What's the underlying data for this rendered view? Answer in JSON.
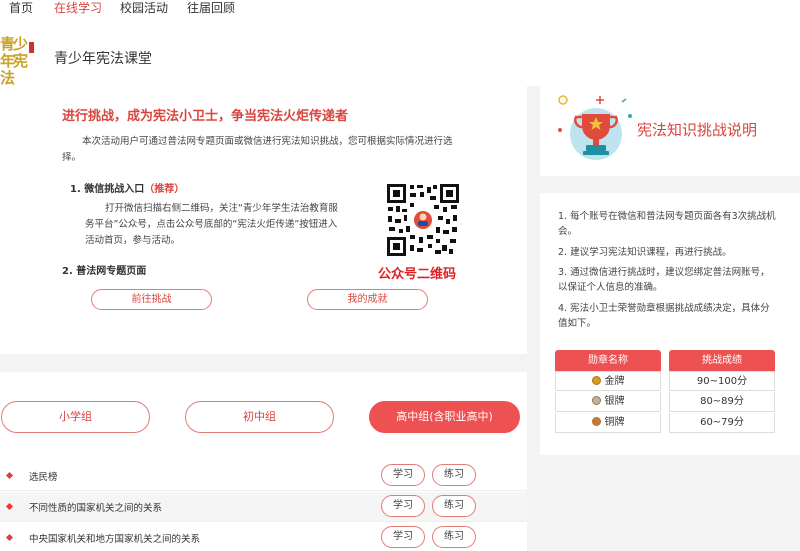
{
  "nav": {
    "items": [
      {
        "label": "首页"
      },
      {
        "label": "在线学习"
      },
      {
        "label": "校园活动"
      },
      {
        "label": "往届回顾"
      }
    ],
    "active_label": "在线学习"
  },
  "header": {
    "logo_text": "青少年宪法",
    "site_title": "青少年宪法课堂"
  },
  "challenge": {
    "headline": "进行挑战，成为宪法小卫士，争当宪法火炬传递者",
    "intro": "本次活动用户可通过普法网专题页面或微信进行宪法知识挑战，您可根据实际情况进行选择。",
    "section1_title": "1. 微信挑战入口",
    "section1_badge": "（推荐）",
    "section1_text": "打开微信扫描右侧二维码，关注“青少年学生法治教育服务平台”公众号，点击公众号底部的“宪法火炬传递”按钮进入活动首页，参与活动。",
    "section2_title": "2. 普法网专题页面",
    "qr_label": "公众号二维码",
    "goto_button": "前往挑战",
    "results_button": "我的成就"
  },
  "info": {
    "title": "宪法知识挑战说明",
    "rules": [
      "1. 每个账号在微信和普法网专题页面各有3次挑战机会。",
      "2. 建议学习宪法知识课程，再进行挑战。",
      "3. 通过微信进行挑战时，建议您绑定普法网账号，以保证个人信息的准确。",
      "4. 宪法小卫士荣誉勋章根据挑战成绩决定，具体分值如下。"
    ],
    "table": {
      "headers": [
        "勋章名称",
        "挑战成绩"
      ],
      "rows": [
        {
          "medal": "金牌",
          "score": "90~100分",
          "color": "#d4a017"
        },
        {
          "medal": "银牌",
          "score": "80~89分",
          "color": "#b0b4b8"
        },
        {
          "medal": "铜牌",
          "score": "60~79分",
          "color": "#c07a3a"
        }
      ]
    }
  },
  "groups": {
    "tabs": [
      {
        "label": "小学组"
      },
      {
        "label": "初中组"
      },
      {
        "label": "高中组(含职业高中)"
      }
    ],
    "active_tab": "高中组(含职业高中)",
    "items": [
      {
        "title": "选民榜",
        "study": "学习",
        "practice": "练习"
      },
      {
        "title": "不同性质的国家机关之间的关系",
        "study": "学习",
        "practice": "练习"
      },
      {
        "title": "中央国家机关和地方国家机关之间的关系",
        "study": "学习",
        "practice": "练习"
      }
    ]
  },
  "colors": {
    "accent": "#d9453f",
    "accent_fill": "#ee5151",
    "qr_label": "#e02020"
  }
}
